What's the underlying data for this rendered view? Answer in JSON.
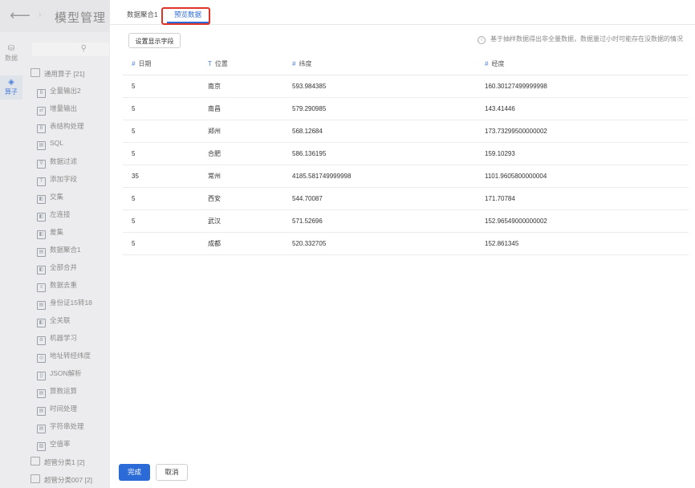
{
  "header": {
    "back_icon": "arrow-left-icon",
    "title": "模型管理"
  },
  "rail": [
    {
      "icon": "database-icon",
      "label": "数据",
      "active": false
    },
    {
      "icon": "layers-icon",
      "label": "算子",
      "active": true
    }
  ],
  "search": {
    "icon": "search-icon"
  },
  "tree": {
    "group_general": "通用算子 [21]",
    "items": [
      "全量输出2",
      "增量输出",
      "表结构处理",
      "SQL",
      "数据过滤",
      "添加字段",
      "交集",
      "左连接",
      "差集",
      "数据聚合1",
      "全部合并",
      "数据去重",
      "身份证15转18",
      "全关联",
      "机器学习",
      "地址转经纬度",
      "JSON解析",
      "算数运算",
      "时间处理",
      "字符串处理",
      "空值率"
    ],
    "item_icons": [
      "B",
      "⇄",
      "B",
      "▤",
      "∇",
      "T",
      "◧",
      "◧",
      "◧",
      "▤",
      "◧",
      "≡",
      "▤",
      "◧",
      "⚙",
      "◎",
      "{}",
      "▤",
      "▤",
      "▤",
      "▧"
    ],
    "group_super1": "超管分类1 [2]",
    "group_super007": "超管分类007 [2]"
  },
  "tabs": {
    "tab1": "数据聚合1",
    "tab2": "预览数据"
  },
  "toolbar": {
    "set_fields_label": "设置显示字段"
  },
  "info": {
    "icon": "info-icon",
    "text": "基于抽样数据得出非全量数据，数据量过小时可能存在没数据的情况"
  },
  "table": {
    "headers": [
      {
        "type": "#",
        "label": "日期"
      },
      {
        "type": "T",
        "label": "位置"
      },
      {
        "type": "#",
        "label": "纬度"
      },
      {
        "type": "#",
        "label": "经度"
      }
    ],
    "rows": [
      [
        "5",
        "南京",
        "593.984385",
        "160.30127499999998"
      ],
      [
        "5",
        "南昌",
        "579.290985",
        "143.41446"
      ],
      [
        "5",
        "郑州",
        "568.12684",
        "173.73299500000002"
      ],
      [
        "5",
        "合肥",
        "586.136195",
        "159.10293"
      ],
      [
        "35",
        "常州",
        "4185.581749999998",
        "1101.9605800000004"
      ],
      [
        "5",
        "西安",
        "544.70087",
        "171.70784"
      ],
      [
        "5",
        "武汉",
        "571.52696",
        "152.96549000000002"
      ],
      [
        "5",
        "成都",
        "520.332705",
        "152.861345"
      ]
    ]
  },
  "footer": {
    "done_label": "完成",
    "cancel_label": "取消"
  },
  "colors": {
    "accent": "#2b6bd8",
    "highlight": "#e0342a"
  }
}
